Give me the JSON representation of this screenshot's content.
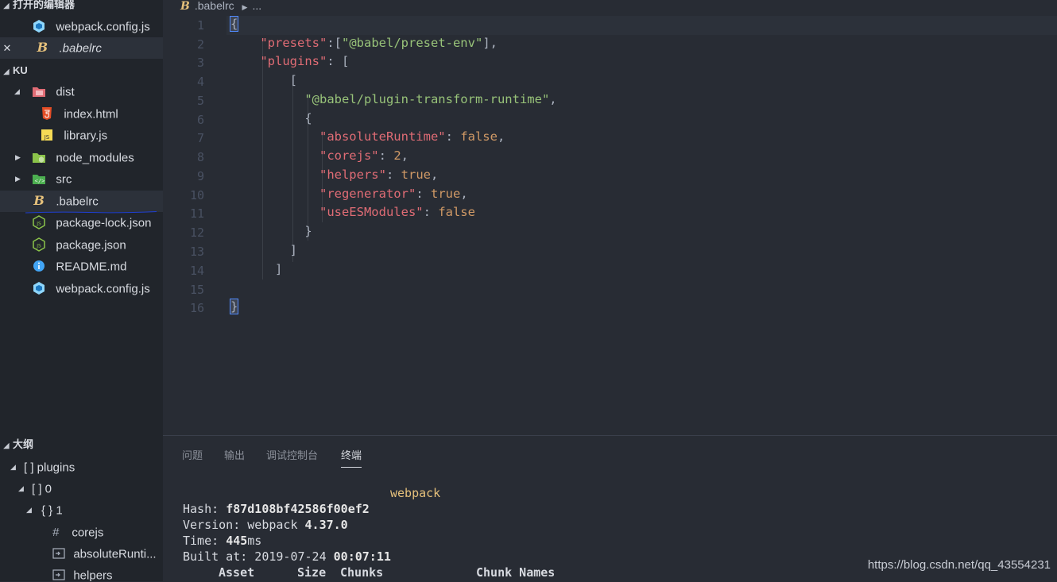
{
  "sidebar": {
    "open_editors_title": "打开的编辑器",
    "open_editors": [
      {
        "label": "webpack.config.js"
      },
      {
        "label": ".babelrc",
        "close": "✕"
      }
    ],
    "project_title": "KU",
    "tree": [
      {
        "label": "dist"
      },
      {
        "label": "index.html"
      },
      {
        "label": "library.js"
      },
      {
        "label": "node_modules"
      },
      {
        "label": "src"
      },
      {
        "label": ".babelrc"
      },
      {
        "label": "package-lock.json"
      },
      {
        "label": "package.json"
      },
      {
        "label": "README.md"
      },
      {
        "label": "webpack.config.js"
      }
    ],
    "outline_title": "大纲",
    "outline": [
      {
        "label": "[ ] plugins"
      },
      {
        "label": "[ ] 0"
      },
      {
        "label": "{ } 1"
      },
      {
        "label": "corejs"
      },
      {
        "label": "absoluteRunti..."
      },
      {
        "label": "helpers"
      }
    ]
  },
  "editor": {
    "breadcrumb_file": ".babelrc",
    "breadcrumb_rest": "...",
    "line_numbers": [
      "1",
      "2",
      "3",
      "4",
      "5",
      "6",
      "7",
      "8",
      "9",
      "10",
      "11",
      "12",
      "13",
      "14",
      "15",
      "16"
    ]
  },
  "panel": {
    "tabs": [
      "问题",
      "输出",
      "调试控制台",
      "终端"
    ],
    "terminal": {
      "title": "webpack",
      "hash_label": "Hash: ",
      "hash": "f87d108bf42586f00ef2",
      "version_label": "Version: webpack ",
      "version": "4.37.0",
      "time_label": "Time: ",
      "time_value": "445",
      "time_unit": "ms",
      "built_label": "Built at: 2019-07-24 ",
      "built_time": "00:07:11",
      "header_asset": "Asset",
      "header_size": "Size",
      "header_chunks": "Chunks",
      "header_names": "Chunk Names"
    }
  },
  "watermark": "https://blog.csdn.net/qq_43554231",
  "colors": {
    "accent_underline": "#1f3fd1"
  }
}
